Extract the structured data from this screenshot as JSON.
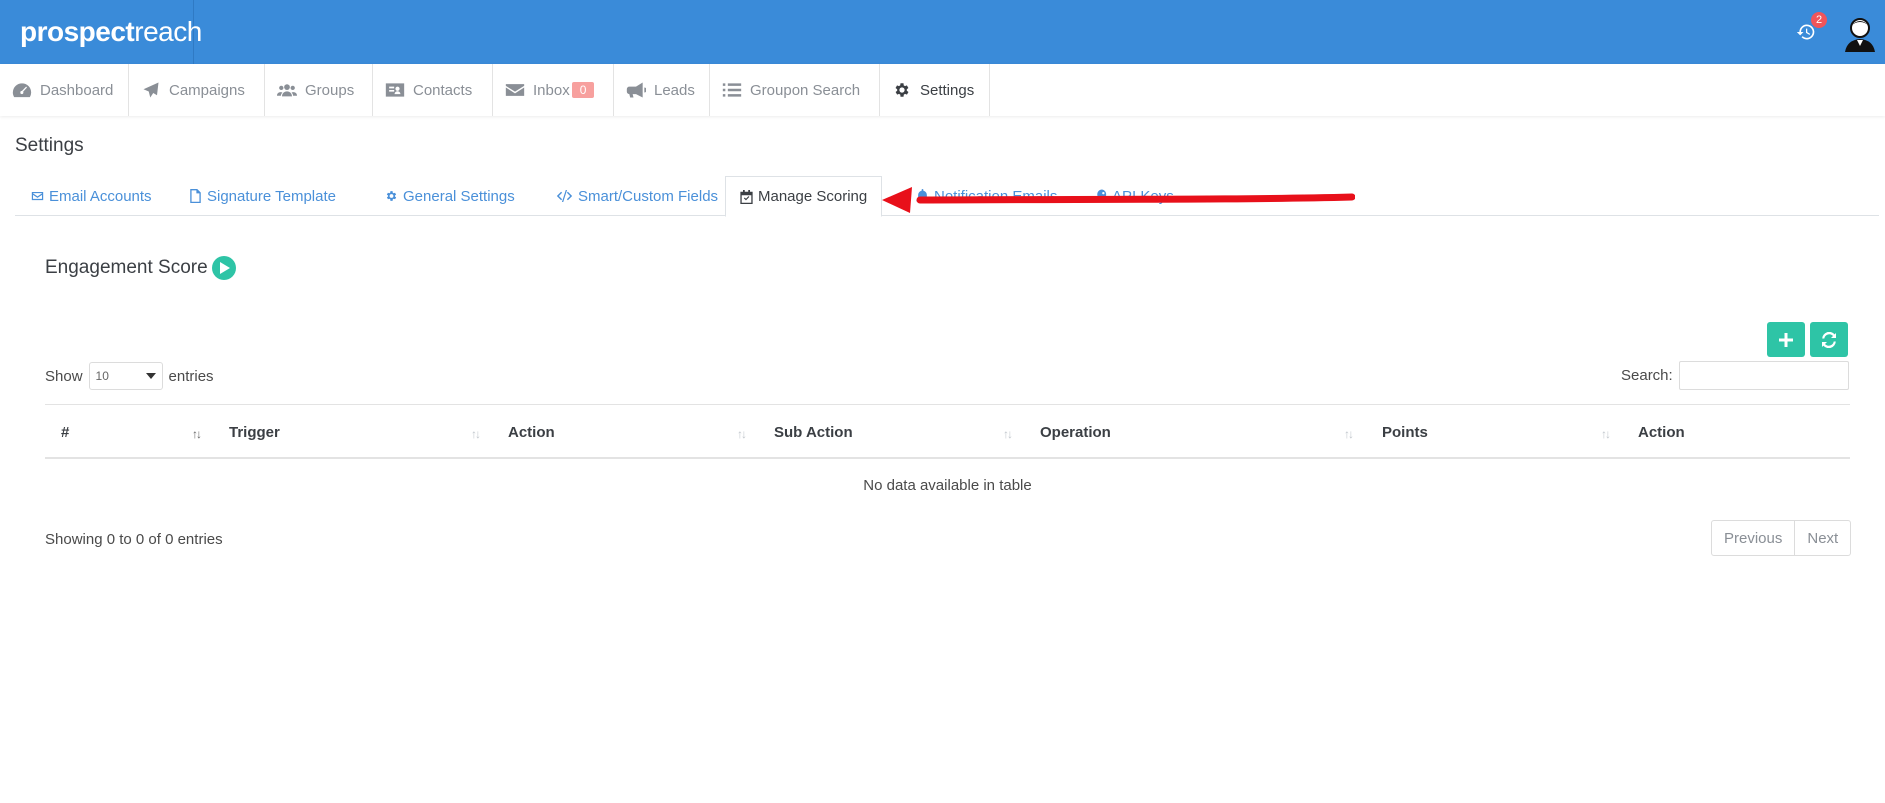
{
  "brand": {
    "bold": "prospect",
    "light": "reach"
  },
  "header": {
    "notification_count": "2"
  },
  "nav": [
    {
      "label": "Dashboard",
      "icon": "dashboard-icon"
    },
    {
      "label": "Campaigns",
      "icon": "paper-plane-icon"
    },
    {
      "label": "Groups",
      "icon": "users-icon"
    },
    {
      "label": "Contacts",
      "icon": "contact-card-icon"
    },
    {
      "label": "Inbox",
      "icon": "envelope-icon",
      "badge": "0"
    },
    {
      "label": "Leads",
      "icon": "megaphone-icon"
    },
    {
      "label": "Groupon Search",
      "icon": "list-icon"
    },
    {
      "label": "Settings",
      "icon": "gear-icon",
      "active": true
    }
  ],
  "page": {
    "title": "Settings"
  },
  "tabs": [
    {
      "label": "Email Accounts",
      "icon": "envelope-outline-icon"
    },
    {
      "label": "Signature Template",
      "icon": "file-icon"
    },
    {
      "label": "General Settings",
      "icon": "gear-icon"
    },
    {
      "label": "Smart/Custom Fields",
      "icon": "code-icon"
    },
    {
      "label": "Manage Scoring",
      "icon": "calendar-check-icon",
      "active": true
    },
    {
      "label": "Notification Emails",
      "icon": "bell-icon"
    },
    {
      "label": "API Keys",
      "icon": "key-icon"
    }
  ],
  "section": {
    "title": "Engagement Score"
  },
  "table_controls": {
    "show_label": "Show",
    "entries_label": "entries",
    "page_length": "10",
    "search_label": "Search:",
    "search_value": ""
  },
  "table": {
    "columns": [
      "#",
      "Trigger",
      "Action",
      "Sub Action",
      "Operation",
      "Points",
      "Action"
    ],
    "empty_message": "No data available in table",
    "info": "Showing 0 to 0 of 0 entries"
  },
  "pagination": {
    "previous": "Previous",
    "next": "Next"
  },
  "colors": {
    "header_blue": "#3a8bd9",
    "accent_green": "#2ec4a6",
    "link_blue": "#4a90d9",
    "annotation_red": "#e8101a"
  }
}
